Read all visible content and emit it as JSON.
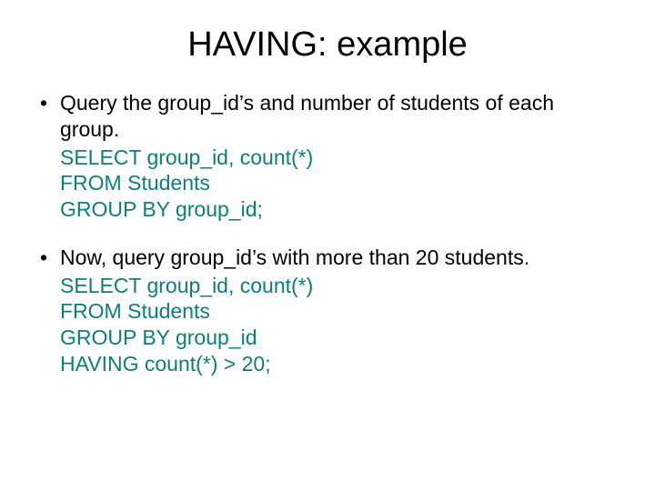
{
  "title": "HAVING: example",
  "bullets": [
    {
      "desc": "Query the group_id’s and number of students of each group.",
      "sql": [
        "SELECT group_id, count(*)",
        "FROM Students",
        "GROUP BY group_id;"
      ]
    },
    {
      "desc": "Now, query group_id’s with more than 20 students.",
      "sql": [
        "SELECT group_id, count(*)",
        "FROM Students",
        "GROUP BY group_id",
        "HAVING count(*) > 20;"
      ]
    }
  ]
}
